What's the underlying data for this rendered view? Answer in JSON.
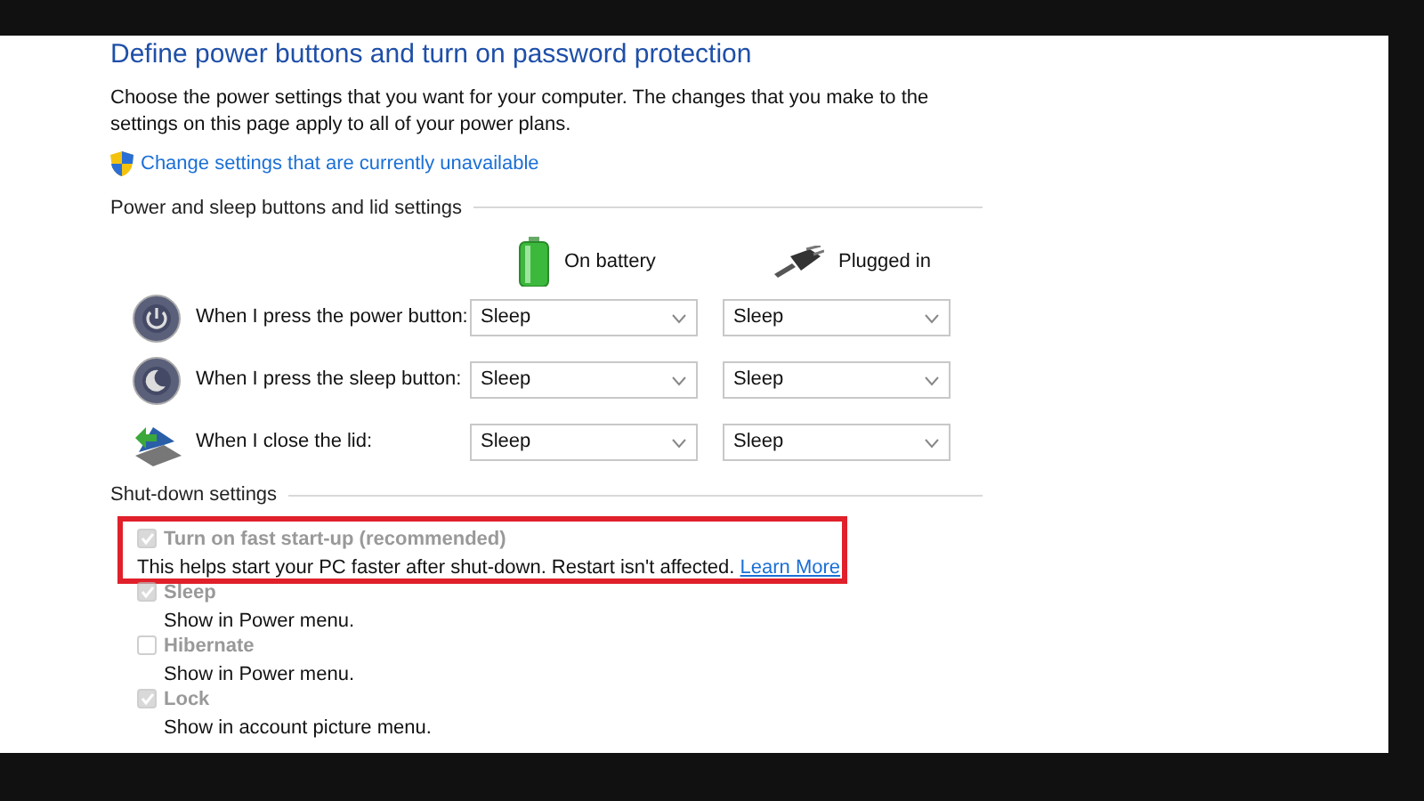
{
  "title": "Define power buttons and turn on password protection",
  "intro": "Choose the power settings that you want for your computer. The changes that you make to the settings on this page apply to all of your power plans.",
  "admin_link": "Change settings that are currently unavailable",
  "buttons_section": {
    "heading": "Power and sleep buttons and lid settings",
    "columns": [
      {
        "kind": "battery",
        "label": "On battery"
      },
      {
        "kind": "plug",
        "label": "Plugged in"
      }
    ],
    "rows": [
      {
        "kind": "power",
        "label": "When I press the power button:",
        "values": [
          "Sleep",
          "Sleep"
        ]
      },
      {
        "kind": "sleep",
        "label": "When I press the sleep button:",
        "values": [
          "Sleep",
          "Sleep"
        ]
      },
      {
        "kind": "lid",
        "label": "When I close the lid:",
        "values": [
          "Sleep",
          "Sleep"
        ]
      }
    ]
  },
  "shutdown_section": {
    "heading": "Shut-down settings",
    "options": [
      {
        "label": "Turn on fast start-up (recommended)",
        "description": "This helps start your PC faster after shut-down. Restart isn't affected.",
        "link": "Learn More",
        "checked": true,
        "disabled": true,
        "highlighted": true
      },
      {
        "label": "Sleep",
        "description": "Show in Power menu.",
        "checked": true,
        "disabled": true,
        "highlighted": false
      },
      {
        "label": "Hibernate",
        "description": "Show in Power menu.",
        "checked": false,
        "disabled": true,
        "highlighted": false
      },
      {
        "label": "Lock",
        "description": "Show in account picture menu.",
        "checked": true,
        "disabled": true,
        "highlighted": false
      }
    ]
  }
}
